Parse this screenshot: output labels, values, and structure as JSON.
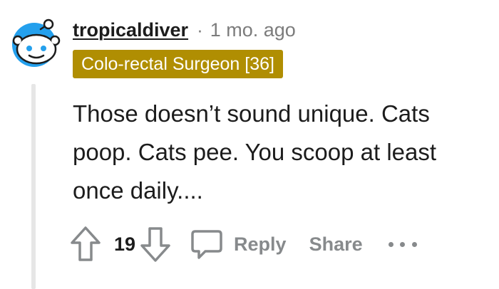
{
  "comment": {
    "author": "tropicaldiver",
    "separator": "·",
    "time_ago": "1 mo. ago",
    "flair": "Colo-rectal Surgeon [36]",
    "text": "Those doesn’t sound unique. Cats poop. Cats pee. You scoop at least once daily....",
    "score": "19"
  },
  "actions": {
    "reply_label": "Reply",
    "share_label": "Share"
  },
  "icons": {
    "avatar": "snoo-avatar-icon",
    "upvote": "arrow-up-icon",
    "downvote": "arrow-down-icon",
    "reply": "speech-bubble-icon",
    "more": "ellipsis-icon"
  },
  "colors": {
    "flair_background": "#b08e02",
    "avatar_background": "#24a0ed",
    "muted_text": "#878a8c"
  }
}
